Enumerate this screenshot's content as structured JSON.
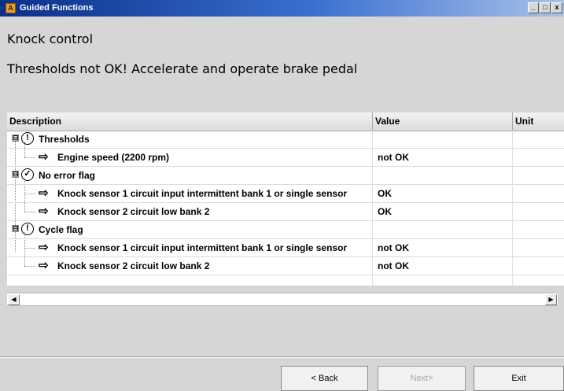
{
  "window": {
    "title": "Guided Functions",
    "icon_letter": "A",
    "buttons": {
      "minimize": "_",
      "maximize": "□",
      "close": "x"
    }
  },
  "main": {
    "heading": "Knock control",
    "instruction": "Thresholds not OK! Accelerate and operate brake pedal"
  },
  "table": {
    "columns": [
      "Description",
      "Value",
      "Unit"
    ],
    "rows": [
      {
        "label": "Thresholds",
        "value": "",
        "unit": ""
      },
      {
        "label": "Engine speed (2200 rpm)",
        "value": "not OK",
        "unit": ""
      },
      {
        "label": "No error flag",
        "value": "",
        "unit": ""
      },
      {
        "label": "Knock sensor 1 circuit input intermittent bank 1 or single sensor",
        "value": "OK",
        "unit": ""
      },
      {
        "label": "Knock sensor 2 circuit low bank 2",
        "value": "OK",
        "unit": ""
      },
      {
        "label": "Cycle flag",
        "value": "",
        "unit": ""
      },
      {
        "label": "Knock sensor 1 circuit input intermittent bank 1 or single sensor",
        "value": "not OK",
        "unit": ""
      },
      {
        "label": "Knock sensor 2 circuit low bank 2",
        "value": "not OK",
        "unit": ""
      }
    ]
  },
  "icons": {
    "expanded": "⊟",
    "warning": "!",
    "check": "✓",
    "arrow": "⇨",
    "scroll_left": "◀",
    "scroll_right": "▶"
  },
  "footer": {
    "back_label": "< Back",
    "next_label": "Next>",
    "exit_label": "Exit"
  }
}
